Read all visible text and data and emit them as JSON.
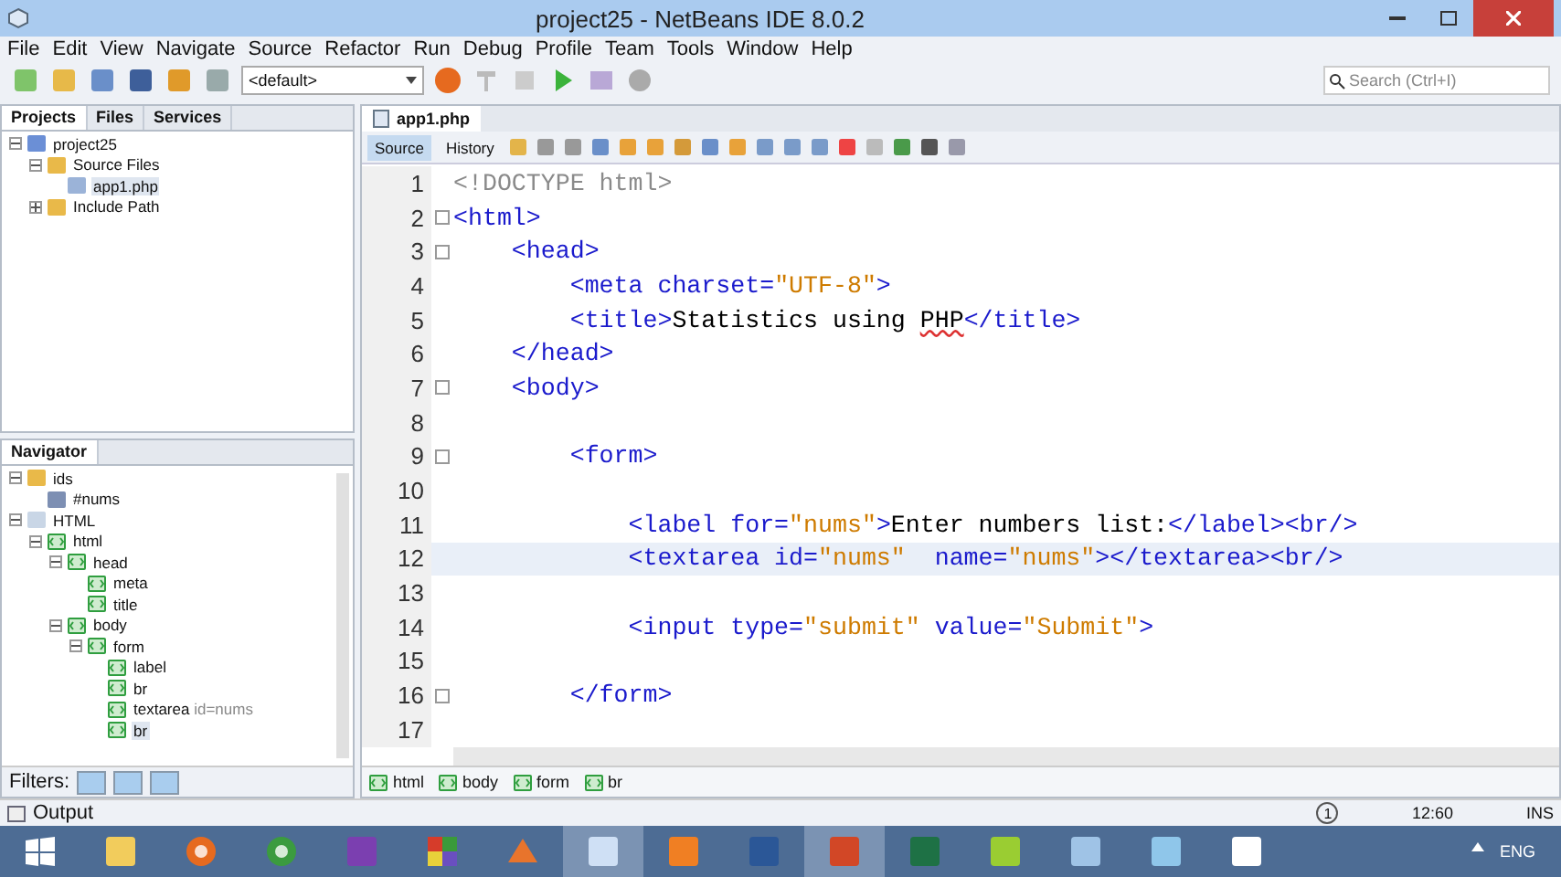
{
  "window": {
    "title": "project25 - NetBeans IDE 8.0.2"
  },
  "menu": [
    "File",
    "Edit",
    "View",
    "Navigate",
    "Source",
    "Refactor",
    "Run",
    "Debug",
    "Profile",
    "Team",
    "Tools",
    "Window",
    "Help"
  ],
  "toolbar": {
    "config": "<default>",
    "search_placeholder": "Search (Ctrl+I)"
  },
  "projects_panel": {
    "tabs": [
      {
        "label": "Projects",
        "selected": true
      },
      {
        "label": "Files",
        "selected": false
      },
      {
        "label": "Services",
        "selected": false
      }
    ],
    "tree": [
      {
        "label": "project25",
        "kind": "project",
        "expanded": true,
        "selected": false,
        "children": [
          {
            "label": "Source Files",
            "kind": "folder",
            "expanded": true,
            "selected": false,
            "children": [
              {
                "label": "app1.php",
                "kind": "file",
                "selected": true
              }
            ]
          },
          {
            "label": "Include Path",
            "kind": "folder",
            "expanded": false,
            "selected": false
          }
        ]
      }
    ]
  },
  "navigator": {
    "title": "Navigator",
    "tree": [
      {
        "label": "ids",
        "kind": "folder",
        "expanded": true,
        "selected": false,
        "children": [
          {
            "label": "#nums",
            "kind": "css-id",
            "selected": false
          }
        ]
      },
      {
        "label": "HTML",
        "kind": "html-file",
        "expanded": true,
        "selected": false,
        "children": [
          {
            "label": "html",
            "kind": "tag",
            "expanded": true,
            "selected": false,
            "children": [
              {
                "label": "head",
                "kind": "tag",
                "expanded": true,
                "selected": false,
                "children": [
                  {
                    "label": "meta",
                    "kind": "tag",
                    "selected": false
                  },
                  {
                    "label": "title",
                    "kind": "tag",
                    "selected": false
                  }
                ]
              },
              {
                "label": "body",
                "kind": "tag",
                "expanded": true,
                "selected": false,
                "children": [
                  {
                    "label": "form",
                    "kind": "tag",
                    "expanded": true,
                    "selected": false,
                    "children": [
                      {
                        "label": "label",
                        "kind": "tag",
                        "selected": false
                      },
                      {
                        "label": "br",
                        "kind": "tag",
                        "selected": false
                      },
                      {
                        "label": "textarea",
                        "detail": "id=nums",
                        "kind": "tag",
                        "selected": false
                      },
                      {
                        "label": "br",
                        "kind": "tag",
                        "selected": true
                      }
                    ]
                  }
                ]
              }
            ]
          }
        ]
      }
    ],
    "filters_label": "Filters:"
  },
  "editor": {
    "tabs": [
      {
        "label": "app1.php",
        "selected": true
      }
    ],
    "view_tabs": [
      {
        "label": "Source",
        "selected": true
      },
      {
        "label": "History",
        "selected": false
      }
    ],
    "lines": [
      {
        "number": "1",
        "fold": false,
        "selected": false,
        "segments": [
          {
            "kind": "doctype",
            "text": "<!DOCTYPE html>"
          }
        ]
      },
      {
        "number": "2",
        "fold": true,
        "selected": false,
        "segments": [
          {
            "kind": "tag",
            "text": "<html>"
          }
        ]
      },
      {
        "number": "3",
        "fold": true,
        "selected": false,
        "segments": [
          {
            "kind": "tag",
            "text": "    <head>"
          }
        ]
      },
      {
        "number": "4",
        "fold": false,
        "selected": false,
        "segments": [
          {
            "kind": "tag",
            "text": "        <meta"
          },
          {
            "kind": "attr",
            "text": " charset="
          },
          {
            "kind": "value",
            "text": "\"UTF-8\""
          },
          {
            "kind": "tag",
            "text": ">"
          }
        ]
      },
      {
        "number": "5",
        "fold": false,
        "selected": false,
        "segments": [
          {
            "kind": "tag",
            "text": "        <title>"
          },
          {
            "kind": "text",
            "text": "Statistics using "
          },
          {
            "kind": "spell",
            "text": "PHP"
          },
          {
            "kind": "tag",
            "text": "</title>"
          }
        ]
      },
      {
        "number": "6",
        "fold": false,
        "selected": false,
        "segments": [
          {
            "kind": "tag",
            "text": "    </head>"
          }
        ]
      },
      {
        "number": "7",
        "fold": true,
        "selected": false,
        "segments": [
          {
            "kind": "tag",
            "text": "    <body>"
          }
        ]
      },
      {
        "number": "8",
        "fold": false,
        "selected": false
      },
      {
        "number": "9",
        "fold": true,
        "selected": false,
        "segments": [
          {
            "kind": "tag",
            "text": "        <form>"
          }
        ]
      },
      {
        "number": "10",
        "fold": false,
        "selected": false
      },
      {
        "number": "11",
        "fold": false,
        "selected": false,
        "segments": [
          {
            "kind": "tag",
            "text": "            <label"
          },
          {
            "kind": "attr",
            "text": " for="
          },
          {
            "kind": "value",
            "text": "\"nums\""
          },
          {
            "kind": "tag",
            "text": ">"
          },
          {
            "kind": "text",
            "text": "Enter numbers list:"
          },
          {
            "kind": "tag",
            "text": "</label><br/>"
          }
        ]
      },
      {
        "number": "12",
        "fold": false,
        "selected": true,
        "segments": [
          {
            "kind": "tag",
            "text": "            <textarea"
          },
          {
            "kind": "attr",
            "text": " id="
          },
          {
            "kind": "value",
            "text": "\"nums\""
          },
          {
            "kind": "attr",
            "text": "  name="
          },
          {
            "kind": "value",
            "text": "\"nums\""
          },
          {
            "kind": "tag",
            "text": "></textarea><br/>"
          }
        ]
      },
      {
        "number": "13",
        "fold": false,
        "selected": false
      },
      {
        "number": "14",
        "fold": false,
        "selected": false,
        "segments": [
          {
            "kind": "tag",
            "text": "            <input"
          },
          {
            "kind": "attr",
            "text": " type="
          },
          {
            "kind": "value",
            "text": "\"submit\""
          },
          {
            "kind": "attr",
            "text": " value="
          },
          {
            "kind": "value",
            "text": "\"Submit\""
          },
          {
            "kind": "tag",
            "text": ">"
          }
        ]
      },
      {
        "number": "15",
        "fold": false,
        "selected": false
      },
      {
        "number": "16",
        "fold": true,
        "selected": false,
        "segments": [
          {
            "kind": "tag",
            "text": "        </form>"
          }
        ]
      },
      {
        "number": "17",
        "fold": false,
        "selected": false
      }
    ],
    "breadcrumbs": [
      "html",
      "body",
      "form",
      "br"
    ]
  },
  "bottom": {
    "output_label": "Output",
    "notifications": "1",
    "position": "12:60",
    "mode": "INS"
  },
  "taskbar": {
    "apps": [
      {
        "kind": "start",
        "active": false
      },
      {
        "kind": "explorer",
        "active": false
      },
      {
        "kind": "firefox",
        "active": false
      },
      {
        "kind": "chrome",
        "active": false
      },
      {
        "kind": "visualstudio",
        "active": false
      },
      {
        "kind": "tiles",
        "active": false
      },
      {
        "kind": "matlab",
        "active": false
      },
      {
        "kind": "netbeans",
        "active": true
      },
      {
        "kind": "xampp",
        "active": false
      },
      {
        "kind": "word",
        "active": false
      },
      {
        "kind": "powerpoint",
        "active": true
      },
      {
        "kind": "excel",
        "active": false
      },
      {
        "kind": "chart",
        "active": false
      },
      {
        "kind": "calculator",
        "active": false
      },
      {
        "kind": "notepad",
        "active": false
      },
      {
        "kind": "camtasia",
        "active": false
      }
    ],
    "language": "ENG"
  }
}
